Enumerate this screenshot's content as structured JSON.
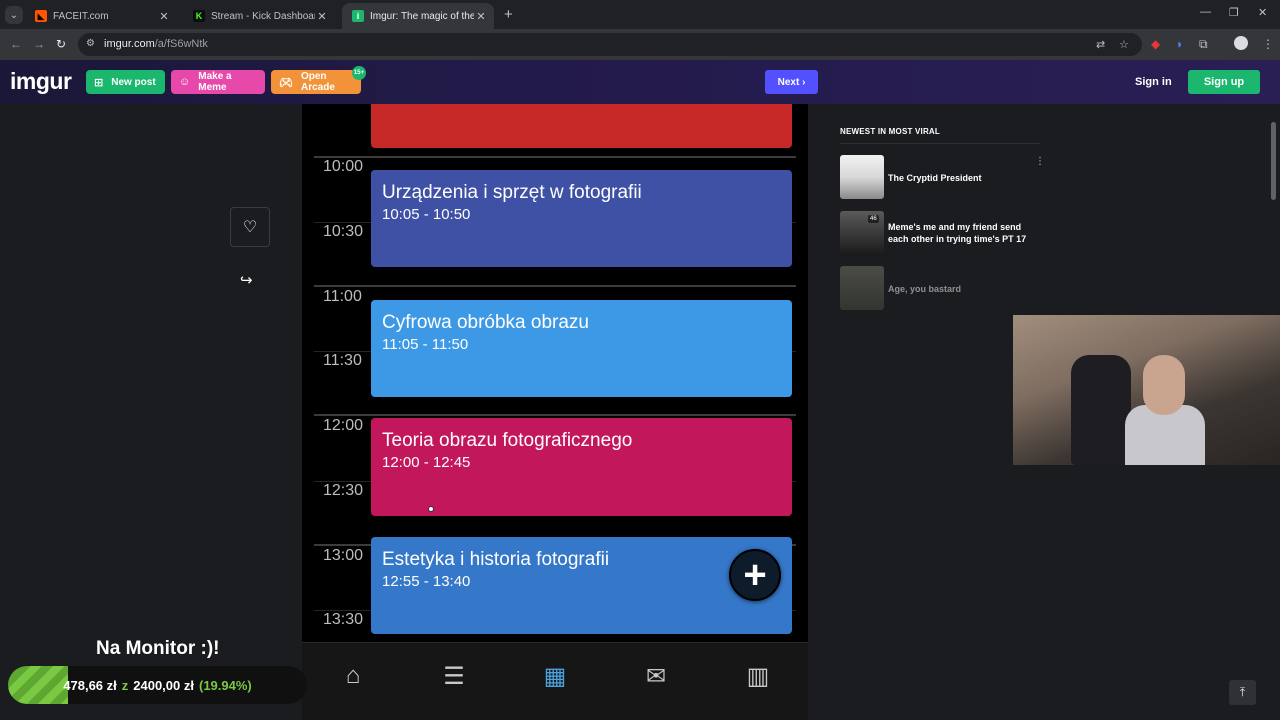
{
  "browser": {
    "tabs": [
      {
        "title": "FACEIT.com",
        "favicon_color": "#ff5500",
        "active": false
      },
      {
        "title": "Stream - Kick Dashboard",
        "favicon_color": "#53fc18",
        "active": false
      },
      {
        "title": "Imgur: The magic of the Interne",
        "favicon_color": "#1bb76e",
        "active": true
      }
    ],
    "url_domain": "imgur.com",
    "url_path": "/a/fS6wNtk"
  },
  "imgur": {
    "logo": "imgur",
    "new_post": "New post",
    "make_meme": "Make a Meme",
    "open_arcade": "Open Arcade",
    "arcade_badge": "15+",
    "next": "Next",
    "sign_in": "Sign in",
    "sign_up": "Sign up"
  },
  "calendar": {
    "time_labels": [
      "10:00",
      "10:30",
      "11:00",
      "11:30",
      "12:00",
      "12:30",
      "13:00",
      "13:30"
    ],
    "events": [
      {
        "name": "",
        "time": "",
        "color": "#c62828"
      },
      {
        "name": "Urządzenia i sprzęt w fotografii",
        "time": "10:05 - 10:50",
        "color": "#3f51a5"
      },
      {
        "name": "Cyfrowa obróbka obrazu",
        "time": "11:05 - 11:50",
        "color": "#3d99e6"
      },
      {
        "name": "Teoria obrazu fotograficznego",
        "time": "12:00 - 12:45",
        "color": "#c2185b"
      },
      {
        "name": "Estetyka i historia fotografii",
        "time": "12:55 - 13:40",
        "color": "#3577c8"
      }
    ],
    "fab_symbol": "+",
    "nav": [
      "home-icon",
      "list-icon",
      "calendar-icon",
      "mail-icon",
      "stats-icon"
    ]
  },
  "sidebar": {
    "heading": "NEWEST IN MOST VIRAL",
    "items": [
      {
        "title": "The Cryptid President",
        "count": ""
      },
      {
        "title": "Meme's me and my friend send each other in trying time's PT 17",
        "count": "46"
      },
      {
        "title": "Age, you bastard",
        "count": ""
      }
    ]
  },
  "overlay": {
    "title": "Na Monitor :)!",
    "raised": "478,66 zł",
    "sep": "z",
    "goal": "2400,00 zł",
    "percent": "(19.94%)",
    "progress_fraction": 0.1994
  }
}
